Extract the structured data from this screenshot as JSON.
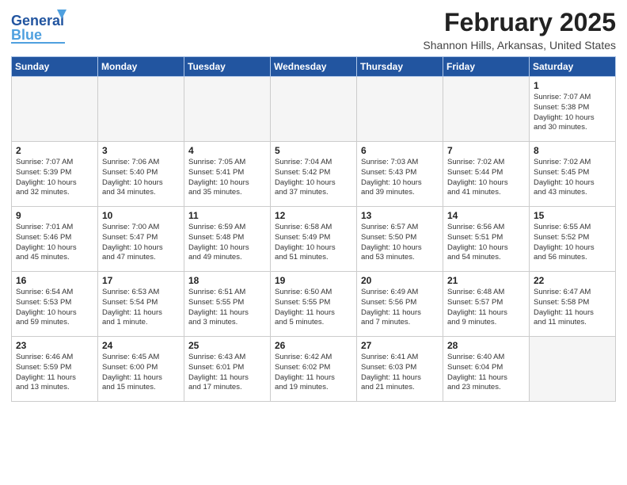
{
  "header": {
    "title": "February 2025",
    "subtitle": "Shannon Hills, Arkansas, United States",
    "logo_general": "General",
    "logo_blue": "Blue"
  },
  "weekdays": [
    "Sunday",
    "Monday",
    "Tuesday",
    "Wednesday",
    "Thursday",
    "Friday",
    "Saturday"
  ],
  "weeks": [
    [
      {
        "day": "",
        "info": ""
      },
      {
        "day": "",
        "info": ""
      },
      {
        "day": "",
        "info": ""
      },
      {
        "day": "",
        "info": ""
      },
      {
        "day": "",
        "info": ""
      },
      {
        "day": "",
        "info": ""
      },
      {
        "day": "1",
        "info": "Sunrise: 7:07 AM\nSunset: 5:38 PM\nDaylight: 10 hours\nand 30 minutes."
      }
    ],
    [
      {
        "day": "2",
        "info": "Sunrise: 7:07 AM\nSunset: 5:39 PM\nDaylight: 10 hours\nand 32 minutes."
      },
      {
        "day": "3",
        "info": "Sunrise: 7:06 AM\nSunset: 5:40 PM\nDaylight: 10 hours\nand 34 minutes."
      },
      {
        "day": "4",
        "info": "Sunrise: 7:05 AM\nSunset: 5:41 PM\nDaylight: 10 hours\nand 35 minutes."
      },
      {
        "day": "5",
        "info": "Sunrise: 7:04 AM\nSunset: 5:42 PM\nDaylight: 10 hours\nand 37 minutes."
      },
      {
        "day": "6",
        "info": "Sunrise: 7:03 AM\nSunset: 5:43 PM\nDaylight: 10 hours\nand 39 minutes."
      },
      {
        "day": "7",
        "info": "Sunrise: 7:02 AM\nSunset: 5:44 PM\nDaylight: 10 hours\nand 41 minutes."
      },
      {
        "day": "8",
        "info": "Sunrise: 7:02 AM\nSunset: 5:45 PM\nDaylight: 10 hours\nand 43 minutes."
      }
    ],
    [
      {
        "day": "9",
        "info": "Sunrise: 7:01 AM\nSunset: 5:46 PM\nDaylight: 10 hours\nand 45 minutes."
      },
      {
        "day": "10",
        "info": "Sunrise: 7:00 AM\nSunset: 5:47 PM\nDaylight: 10 hours\nand 47 minutes."
      },
      {
        "day": "11",
        "info": "Sunrise: 6:59 AM\nSunset: 5:48 PM\nDaylight: 10 hours\nand 49 minutes."
      },
      {
        "day": "12",
        "info": "Sunrise: 6:58 AM\nSunset: 5:49 PM\nDaylight: 10 hours\nand 51 minutes."
      },
      {
        "day": "13",
        "info": "Sunrise: 6:57 AM\nSunset: 5:50 PM\nDaylight: 10 hours\nand 53 minutes."
      },
      {
        "day": "14",
        "info": "Sunrise: 6:56 AM\nSunset: 5:51 PM\nDaylight: 10 hours\nand 54 minutes."
      },
      {
        "day": "15",
        "info": "Sunrise: 6:55 AM\nSunset: 5:52 PM\nDaylight: 10 hours\nand 56 minutes."
      }
    ],
    [
      {
        "day": "16",
        "info": "Sunrise: 6:54 AM\nSunset: 5:53 PM\nDaylight: 10 hours\nand 59 minutes."
      },
      {
        "day": "17",
        "info": "Sunrise: 6:53 AM\nSunset: 5:54 PM\nDaylight: 11 hours\nand 1 minute."
      },
      {
        "day": "18",
        "info": "Sunrise: 6:51 AM\nSunset: 5:55 PM\nDaylight: 11 hours\nand 3 minutes."
      },
      {
        "day": "19",
        "info": "Sunrise: 6:50 AM\nSunset: 5:55 PM\nDaylight: 11 hours\nand 5 minutes."
      },
      {
        "day": "20",
        "info": "Sunrise: 6:49 AM\nSunset: 5:56 PM\nDaylight: 11 hours\nand 7 minutes."
      },
      {
        "day": "21",
        "info": "Sunrise: 6:48 AM\nSunset: 5:57 PM\nDaylight: 11 hours\nand 9 minutes."
      },
      {
        "day": "22",
        "info": "Sunrise: 6:47 AM\nSunset: 5:58 PM\nDaylight: 11 hours\nand 11 minutes."
      }
    ],
    [
      {
        "day": "23",
        "info": "Sunrise: 6:46 AM\nSunset: 5:59 PM\nDaylight: 11 hours\nand 13 minutes."
      },
      {
        "day": "24",
        "info": "Sunrise: 6:45 AM\nSunset: 6:00 PM\nDaylight: 11 hours\nand 15 minutes."
      },
      {
        "day": "25",
        "info": "Sunrise: 6:43 AM\nSunset: 6:01 PM\nDaylight: 11 hours\nand 17 minutes."
      },
      {
        "day": "26",
        "info": "Sunrise: 6:42 AM\nSunset: 6:02 PM\nDaylight: 11 hours\nand 19 minutes."
      },
      {
        "day": "27",
        "info": "Sunrise: 6:41 AM\nSunset: 6:03 PM\nDaylight: 11 hours\nand 21 minutes."
      },
      {
        "day": "28",
        "info": "Sunrise: 6:40 AM\nSunset: 6:04 PM\nDaylight: 11 hours\nand 23 minutes."
      },
      {
        "day": "",
        "info": ""
      }
    ]
  ]
}
